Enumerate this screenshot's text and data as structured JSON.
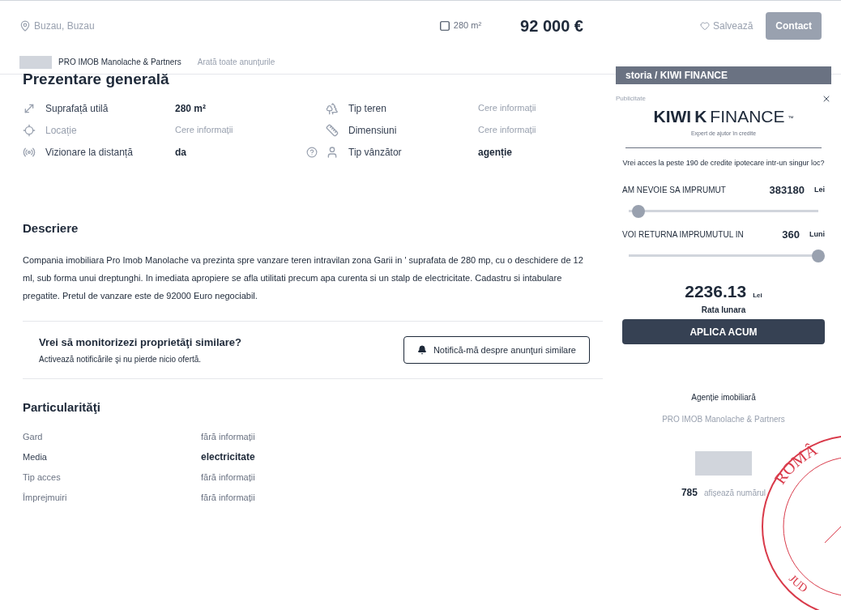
{
  "header": {
    "location": "Buzau, Buzau",
    "area": "280 m²",
    "price": "92 000 €",
    "save": {
      "label": "Salvează",
      "saved": false
    },
    "contact": "Contact"
  },
  "agency_bar": {
    "name": "PRO IMOB Manolache & Partners",
    "link": "Arată toate anunțurile"
  },
  "overview": {
    "title": "Prezentare generală",
    "items": [
      {
        "kind": "area",
        "label": "Suprafață utilă",
        "value": "280 m²",
        "muted": false
      },
      {
        "kind": "terrain",
        "label": "Tip teren",
        "value": "Cere informații",
        "muted": true
      },
      {
        "kind": "location",
        "label": "Locație",
        "value": "Cere informații",
        "muted": true
      },
      {
        "kind": "ruler",
        "label": "Dimensiuni",
        "value": "Cere informații",
        "muted": true
      },
      {
        "kind": "remote",
        "label": "Vizionare la distanță",
        "value": "da",
        "muted": false
      },
      {
        "kind": "user",
        "label": "Tip vânzător",
        "value": "agenție",
        "muted": false
      }
    ]
  },
  "description": {
    "title": "Descriere",
    "text": "Compania imobiliara Pro Imob Manolache va prezinta spre vanzare teren intravilan zona Garii in ' suprafata de 280 mp, cu o deschidere de  12 ml, sub forma unui dreptunghi. In imediata apropiere se afla utilitati precum apa curenta si  un stalp de electricitate. Cadastru si intabulare pregatite. Pretul de vanzare este de 92000 Euro negociabil."
  },
  "alert": {
    "title": "Vrei să monitorizezi proprietăţi similare?",
    "subtitle": "Activează notificările şi nu pierde nicio ofertă.",
    "button": "Notifică-mă despre anunţuri similare"
  },
  "features": {
    "title": "Particularităţi",
    "rows": [
      {
        "label": "Gard",
        "value": "fără informații",
        "muted": true
      },
      {
        "label": "Media",
        "value": "electricitate",
        "muted": false
      },
      {
        "label": "Tip acces",
        "value": "fără informații",
        "muted": true
      },
      {
        "label": "Împrejmuiri",
        "value": "fără informații",
        "muted": true
      }
    ]
  },
  "ad": {
    "banner": "storia / KIWI FINANCE",
    "label": "Publicitate",
    "brand": "KIWI",
    "brand_k": "K",
    "brand_rest": "FINANCE",
    "tm": "™",
    "tagline": "Expert de ajutor în credite",
    "question": "Vrei acces la peste 190 de credite ipotecare intr-un singur loc?",
    "sliders": [
      {
        "label": "AM NEVOIE SA IMPRUMUT",
        "value": "383180",
        "unit": "Lei",
        "level": 0.05
      },
      {
        "label": "VOI RETURNA IMPRUMUTUL IN",
        "value": "360",
        "unit": "Luni",
        "level": 1
      }
    ],
    "rate": "2236.13",
    "rate_unit": "Lei",
    "rate_label": "Rata lunara",
    "apply": "APLICA ACUM"
  },
  "agent": {
    "kind_label": "Agenție imobiliară",
    "name": "PRO IMOB Manolache & Partners",
    "phone_prefix": "785",
    "phone_action": "afișează numărul"
  },
  "stamp": {
    "top": "ROMÂ",
    "bottom": "JUD"
  }
}
